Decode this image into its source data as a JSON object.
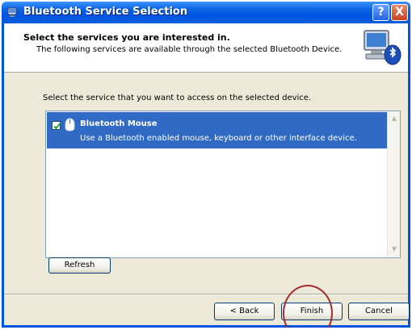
{
  "window": {
    "title": "Bluetooth Service Selection",
    "title_icon": "bluetooth-wizard-icon",
    "help_label": "?",
    "close_label": "X"
  },
  "header": {
    "title": "Select the services you are interested in.",
    "subtitle": "The following services are available through the selected Bluetooth Device.",
    "icon": "bluetooth-computer-icon"
  },
  "instruction": "Select the service that you want to access on the selected device.",
  "services": [
    {
      "name": "Bluetooth Mouse",
      "description": "Use a Bluetooth enabled mouse, keyboard or other interface device.",
      "checked": true,
      "selected": true,
      "icon": "mouse-icon"
    }
  ],
  "buttons": {
    "refresh": "Refresh",
    "back": "< Back",
    "finish": "Finish",
    "cancel": "Cancel"
  },
  "colors": {
    "titlebar": "#0054e3",
    "selection": "#316ac5",
    "dialog_bg": "#ece9d8",
    "annotation_circle": "#a52a2a"
  }
}
